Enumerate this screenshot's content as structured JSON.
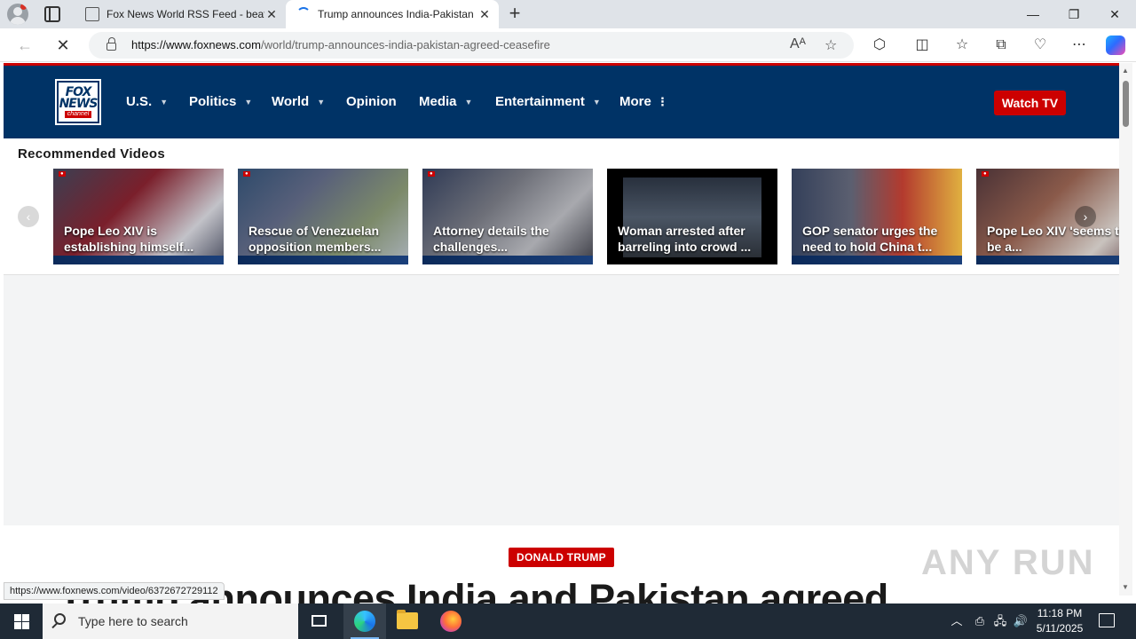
{
  "browser": {
    "tabs": [
      {
        "title": "Fox News World RSS Feed - beat",
        "state": "inactive"
      },
      {
        "title": "Trump announces India-Pakistan",
        "state": "active"
      }
    ],
    "url_domain": "https://www.foxnews.com",
    "url_path": "/world/trump-announces-india-pakistan-agreed-ceasefire",
    "status_url": "https://www.foxnews.com/video/6372672729112"
  },
  "site": {
    "logo_line1": "FOX",
    "logo_line2": "NEWS",
    "logo_line3": "channel",
    "nav": [
      {
        "label": "U.S.",
        "dropdown": true
      },
      {
        "label": "Politics",
        "dropdown": true
      },
      {
        "label": "World",
        "dropdown": true
      },
      {
        "label": "Opinion",
        "dropdown": false
      },
      {
        "label": "Media",
        "dropdown": true
      },
      {
        "label": "Entertainment",
        "dropdown": true
      },
      {
        "label": "More",
        "dropdown": false
      }
    ],
    "watch_tv": "Watch TV",
    "colors": {
      "header": "#003366",
      "accent": "#cc0000"
    }
  },
  "recommended": {
    "title": "Recommended Videos",
    "videos": [
      {
        "caption": "Pope Leo XIV is establishing himself..."
      },
      {
        "caption": "Rescue of Venezuelan opposition members..."
      },
      {
        "caption": "Attorney details the challenges..."
      },
      {
        "caption": "Woman arrested after barreling into crowd ..."
      },
      {
        "caption": "GOP senator urges the need to hold China t..."
      },
      {
        "caption": "Pope Leo XIV 'seems to be a..."
      }
    ]
  },
  "article": {
    "category": "DONALD TRUMP",
    "headline": "Trump announces India and Pakistan agreed"
  },
  "watermark": "ANY RUN",
  "taskbar": {
    "search_placeholder": "Type here to search",
    "time": "11:18 PM",
    "date": "5/11/2025"
  }
}
